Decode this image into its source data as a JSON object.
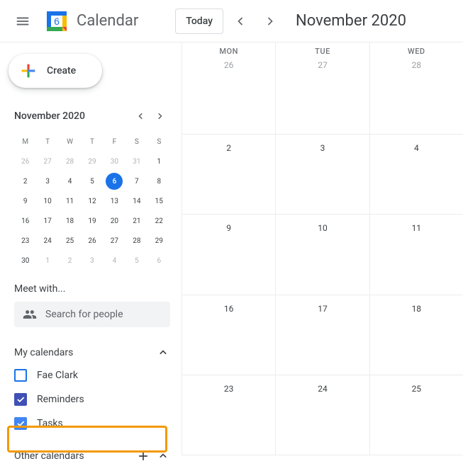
{
  "header": {
    "app_title": "Calendar",
    "today_label": "Today",
    "current_period": "November 2020",
    "logo_day": "6"
  },
  "create_label": "Create",
  "mini": {
    "title": "November 2020",
    "dow": [
      "M",
      "T",
      "W",
      "T",
      "F",
      "S",
      "S"
    ],
    "weeks": [
      [
        {
          "n": "26",
          "m": true
        },
        {
          "n": "27",
          "m": true
        },
        {
          "n": "28",
          "m": true
        },
        {
          "n": "29",
          "m": true
        },
        {
          "n": "30",
          "m": true
        },
        {
          "n": "31",
          "m": true
        },
        {
          "n": "1"
        }
      ],
      [
        {
          "n": "2"
        },
        {
          "n": "3"
        },
        {
          "n": "4"
        },
        {
          "n": "5"
        },
        {
          "n": "6",
          "today": true
        },
        {
          "n": "7"
        },
        {
          "n": "8"
        }
      ],
      [
        {
          "n": "9"
        },
        {
          "n": "10"
        },
        {
          "n": "11"
        },
        {
          "n": "12"
        },
        {
          "n": "13"
        },
        {
          "n": "14"
        },
        {
          "n": "15"
        }
      ],
      [
        {
          "n": "16"
        },
        {
          "n": "17"
        },
        {
          "n": "18"
        },
        {
          "n": "19"
        },
        {
          "n": "20"
        },
        {
          "n": "21"
        },
        {
          "n": "22"
        }
      ],
      [
        {
          "n": "23"
        },
        {
          "n": "24"
        },
        {
          "n": "25"
        },
        {
          "n": "26"
        },
        {
          "n": "27"
        },
        {
          "n": "28"
        },
        {
          "n": "29"
        }
      ],
      [
        {
          "n": "30"
        },
        {
          "n": "1",
          "m": true
        },
        {
          "n": "2",
          "m": true
        },
        {
          "n": "3",
          "m": true
        },
        {
          "n": "4",
          "m": true
        },
        {
          "n": "5",
          "m": true
        },
        {
          "n": "6",
          "m": true
        }
      ]
    ]
  },
  "meet": {
    "title": "Meet with...",
    "placeholder": "Search for people"
  },
  "my_calendars": {
    "title": "My calendars",
    "items": [
      {
        "label": "Fae Clark",
        "checked": false,
        "color": "#1a73e8"
      },
      {
        "label": "Reminders",
        "checked": true,
        "color": "#3f51b5"
      },
      {
        "label": "Tasks",
        "checked": true,
        "color": "#4285f4"
      }
    ]
  },
  "other_calendars": {
    "title": "Other calendars"
  },
  "grid": {
    "days": [
      "MON",
      "TUE",
      "WED"
    ],
    "rows": [
      [
        {
          "n": "26",
          "m": true
        },
        {
          "n": "27",
          "m": true
        },
        {
          "n": "28",
          "m": true
        }
      ],
      [
        {
          "n": "2"
        },
        {
          "n": "3"
        },
        {
          "n": "4"
        }
      ],
      [
        {
          "n": "9"
        },
        {
          "n": "10"
        },
        {
          "n": "11"
        }
      ],
      [
        {
          "n": "16"
        },
        {
          "n": "17"
        },
        {
          "n": "18"
        }
      ],
      [
        {
          "n": "23"
        },
        {
          "n": "24"
        },
        {
          "n": "25"
        }
      ]
    ]
  },
  "colors": {
    "accent": "#1a73e8",
    "highlight": "#f29900"
  }
}
